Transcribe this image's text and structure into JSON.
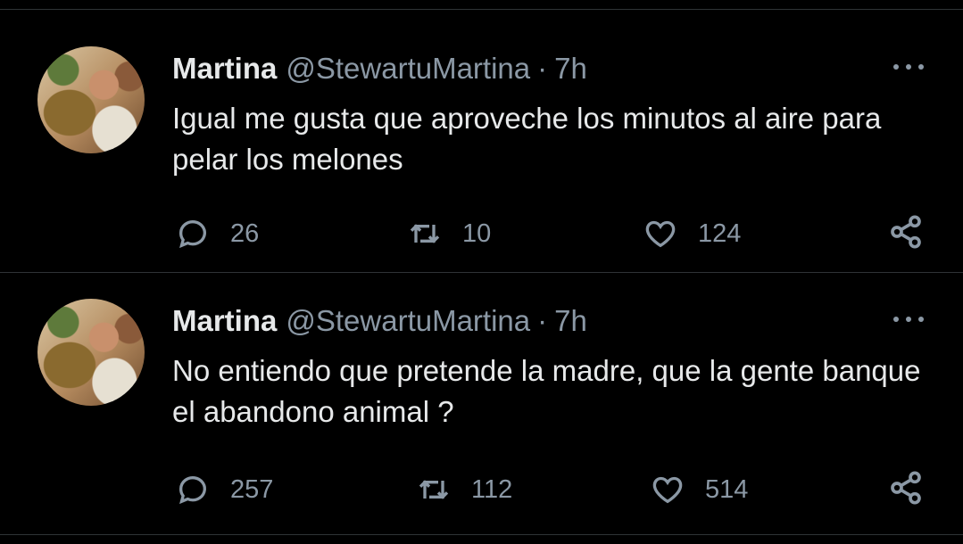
{
  "tweets": [
    {
      "name": "Martina",
      "handle": "@StewartuMartina",
      "separator": "·",
      "time": "7h",
      "text": "Igual me gusta que aproveche los minutos al aire para pelar los melones",
      "replies": "26",
      "retweets": "10",
      "likes": "124"
    },
    {
      "name": "Martina",
      "handle": "@StewartuMartina",
      "separator": "·",
      "time": "7h",
      "text": "No entiendo que pretende la madre, que la gente banque el abandono animal ?",
      "replies": "257",
      "retweets": "112",
      "likes": "514"
    }
  ],
  "icons": [
    "more-icon",
    "reply-icon",
    "retweet-icon",
    "like-icon",
    "share-icon"
  ],
  "colors": {
    "background": "#000000",
    "text": "#e7e9ea",
    "muted": "#8b98a5",
    "divider": "#2f3336"
  }
}
